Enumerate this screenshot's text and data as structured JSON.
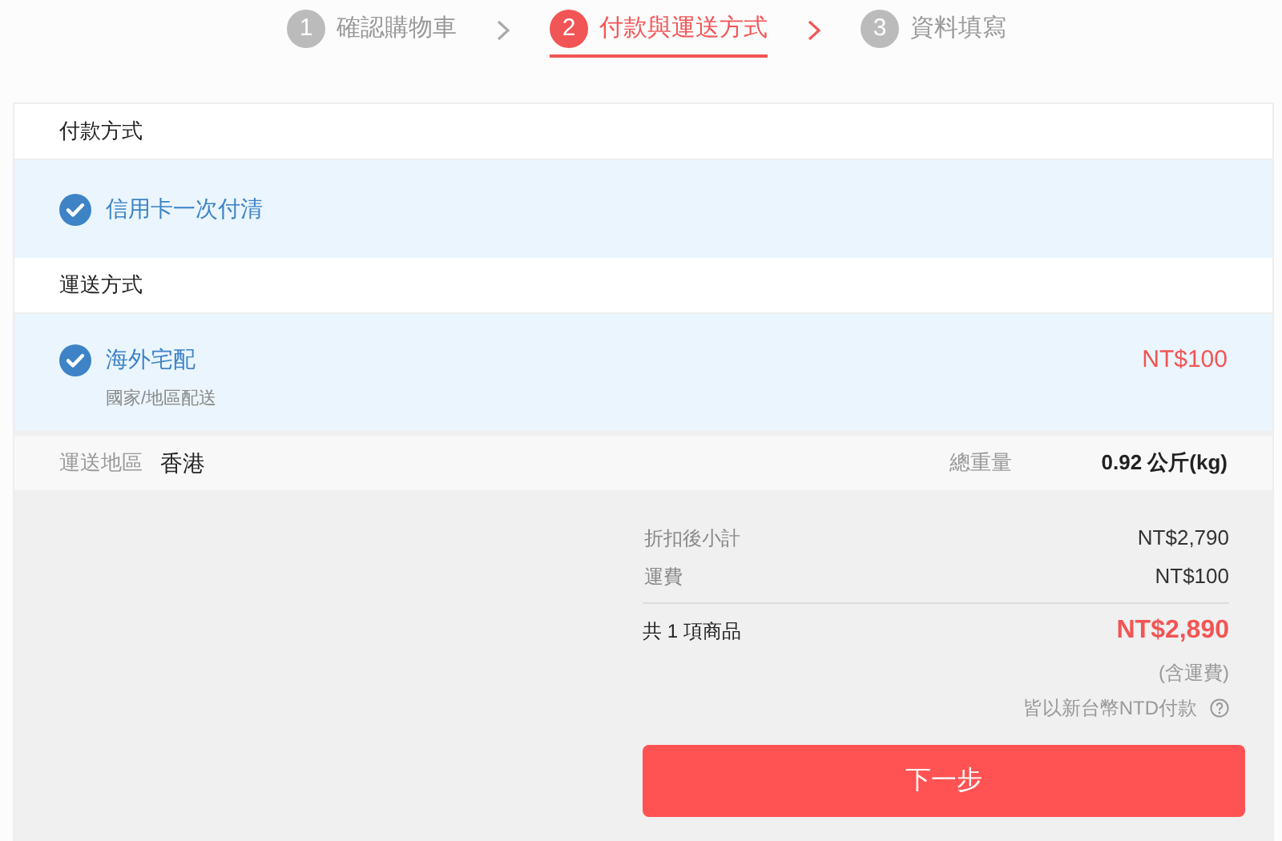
{
  "steps": [
    {
      "number": "1",
      "label": "確認購物車",
      "selected": false
    },
    {
      "number": "2",
      "label": "付款與運送方式",
      "selected": true
    },
    {
      "number": "3",
      "label": "資料填寫",
      "selected": false
    }
  ],
  "payment": {
    "heading": "付款方式",
    "options": [
      {
        "label": "信用卡一次付清",
        "selected": true
      }
    ]
  },
  "shipping": {
    "heading": "運送方式",
    "options": [
      {
        "label": "海外宅配",
        "note": "國家/地區配送",
        "price": "NT$100",
        "selected": true
      }
    ]
  },
  "region": {
    "label": "運送地區",
    "value": "香港",
    "weight_label": "總重量",
    "weight": "0.92 公斤(kg)"
  },
  "summary": {
    "rows": [
      {
        "label": "折扣後小計",
        "value": "NT$2,790"
      },
      {
        "label": "運費",
        "value": "NT$100"
      }
    ],
    "count_label": "共 1 項商品",
    "total": "NT$2,890",
    "total_note": "(含運費)",
    "currency_note": "皆以新台幣NTD付款",
    "next_button": "下一步"
  }
}
